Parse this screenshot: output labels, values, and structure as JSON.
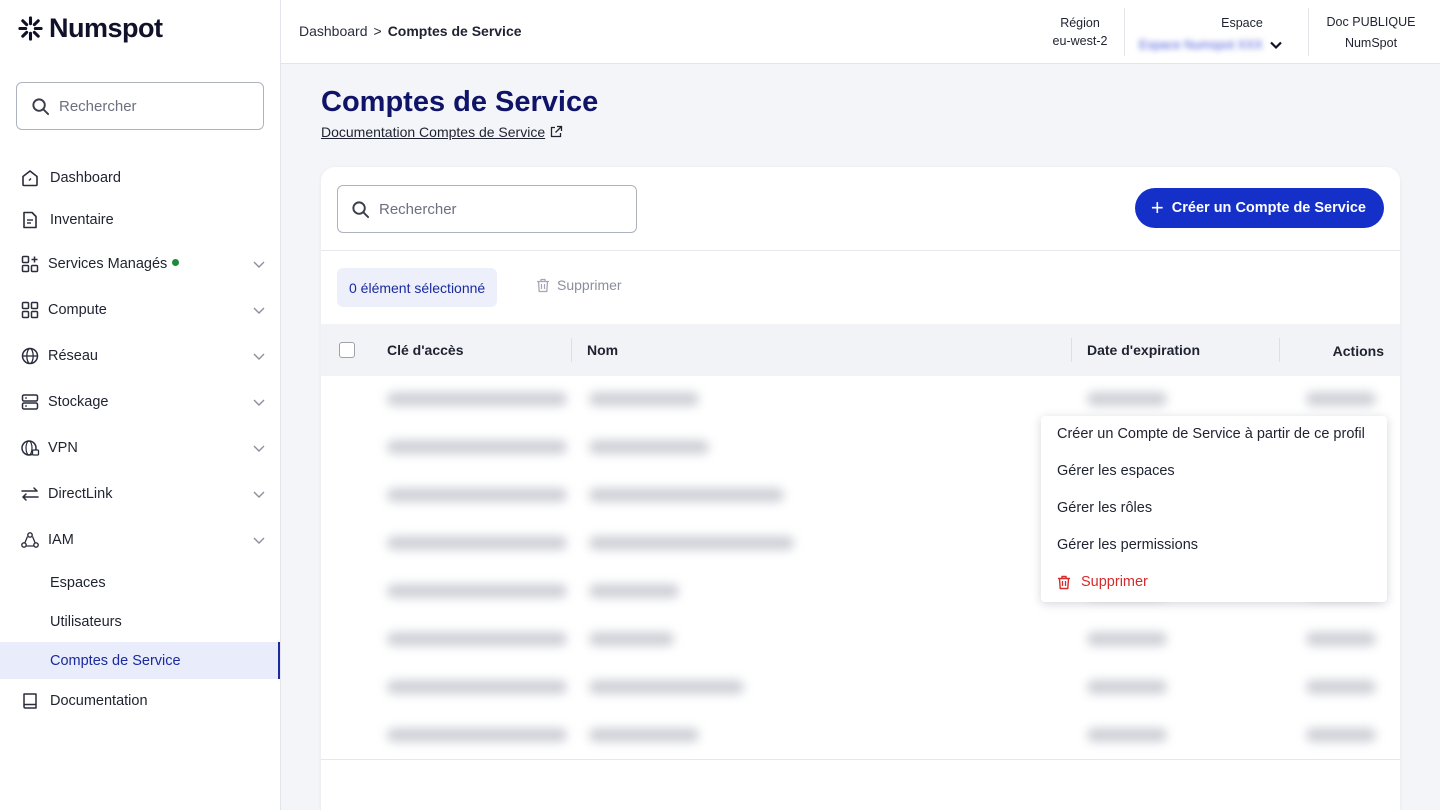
{
  "brand": {
    "name": "Numspot"
  },
  "sidebar": {
    "search_placeholder": "Rechercher",
    "items": [
      {
        "label": "Dashboard",
        "icon": "home-icon"
      },
      {
        "label": "Inventaire",
        "icon": "document-icon"
      },
      {
        "label": "Services Managés",
        "icon": "grid-plus-icon",
        "status_dot": "green"
      },
      {
        "label": "Compute",
        "icon": "grid-icon"
      },
      {
        "label": "Réseau",
        "icon": "globe-icon"
      },
      {
        "label": "Stockage",
        "icon": "storage-icon"
      },
      {
        "label": "VPN",
        "icon": "globe-lock-icon"
      },
      {
        "label": "DirectLink",
        "icon": "arrows-icon"
      },
      {
        "label": "IAM",
        "icon": "users-icon"
      }
    ],
    "iam_children": [
      {
        "label": "Espaces"
      },
      {
        "label": "Utilisateurs"
      },
      {
        "label": "Comptes de Service",
        "active": true
      }
    ],
    "documentation": {
      "label": "Documentation",
      "icon": "book-icon"
    }
  },
  "header": {
    "breadcrumb": {
      "root": "Dashboard",
      "separator": ">",
      "current": "Comptes de Service"
    },
    "region": {
      "label": "Région",
      "value": "eu-west-2"
    },
    "espace": {
      "label": "Espace",
      "value": "Espace Numspot XXX"
    },
    "doc": {
      "label": "Doc PUBLIQUE",
      "value": "NumSpot"
    }
  },
  "main": {
    "title": "Comptes de Service",
    "doc_link": "Documentation Comptes de Service",
    "search_placeholder": "Rechercher",
    "create_button": "Créer un Compte de Service",
    "selection": "0 élément sélectionné",
    "delete_button": "Supprimer",
    "columns": [
      "Clé d'accès",
      "Nom",
      "Date d'expiration",
      "Actions"
    ]
  },
  "context_menu": {
    "items": [
      {
        "label": "Créer un Compte de Service à partir de ce profil"
      },
      {
        "label": "Gérer les espaces"
      },
      {
        "label": "Gérer les rôles"
      },
      {
        "label": "Gérer les permissions"
      },
      {
        "label": "Supprimer",
        "danger": true,
        "icon": "trash-icon"
      }
    ]
  },
  "colors": {
    "accent": "#1430c8",
    "title": "#0f1468",
    "danger": "#d42b2b",
    "active_bg": "#e9ecfb"
  }
}
